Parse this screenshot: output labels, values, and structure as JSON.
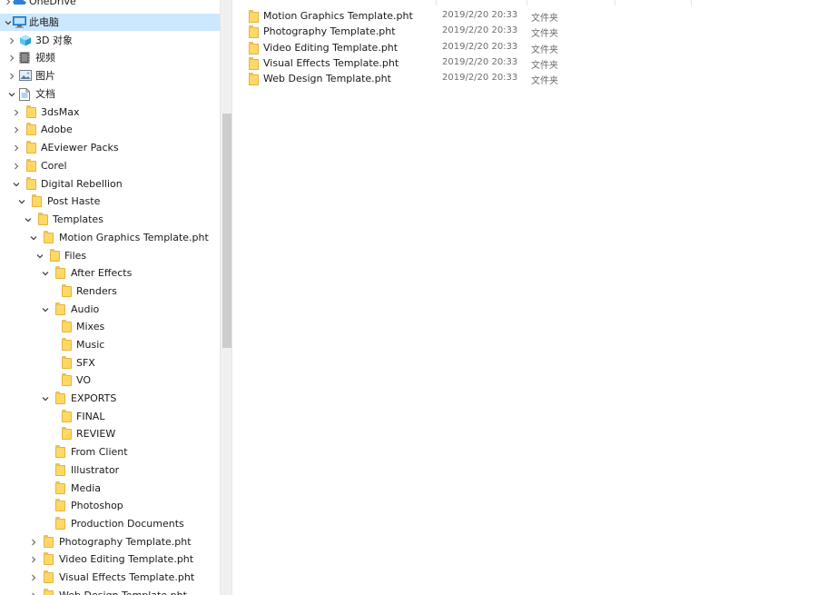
{
  "nav_tree": [
    {
      "label": "OneDrive",
      "icon": "cloud-icon",
      "chevron": "right"
    },
    {
      "label": "此电脑",
      "icon": "computer-icon",
      "chevron": "down",
      "selected": true
    },
    {
      "label": "3D 对象",
      "icon": "cube-3d-icon",
      "chevron": "right"
    },
    {
      "label": "视频",
      "icon": "video-icon",
      "chevron": "right"
    },
    {
      "label": "图片",
      "icon": "pictures-icon",
      "chevron": "right"
    },
    {
      "label": "文档",
      "icon": "documents-icon",
      "chevron": "down"
    },
    {
      "label": "3dsMax",
      "icon": "folder-icon",
      "chevron": "right"
    },
    {
      "label": "Adobe",
      "icon": "folder-icon",
      "chevron": "right"
    },
    {
      "label": "AEviewer Packs",
      "icon": "folder-icon",
      "chevron": "right"
    },
    {
      "label": "Corel",
      "icon": "folder-icon",
      "chevron": "right"
    },
    {
      "label": "Digital Rebellion",
      "icon": "folder-icon",
      "chevron": "down"
    },
    {
      "label": "Post Haste",
      "icon": "folder-icon",
      "chevron": "down"
    },
    {
      "label": "Templates",
      "icon": "folder-icon",
      "chevron": "down"
    },
    {
      "label": "Motion Graphics Template.pht",
      "icon": "folder-icon",
      "chevron": "down"
    },
    {
      "label": "Files",
      "icon": "folder-icon",
      "chevron": "down"
    },
    {
      "label": "After Effects",
      "icon": "folder-icon",
      "chevron": "down"
    },
    {
      "label": "Renders",
      "icon": "folder-icon",
      "chevron": "none"
    },
    {
      "label": "Audio",
      "icon": "folder-icon",
      "chevron": "down"
    },
    {
      "label": "Mixes",
      "icon": "folder-icon",
      "chevron": "none"
    },
    {
      "label": "Music",
      "icon": "folder-icon",
      "chevron": "none"
    },
    {
      "label": "SFX",
      "icon": "folder-icon",
      "chevron": "none"
    },
    {
      "label": "VO",
      "icon": "folder-icon",
      "chevron": "none"
    },
    {
      "label": "EXPORTS",
      "icon": "folder-icon",
      "chevron": "down"
    },
    {
      "label": "FINAL",
      "icon": "folder-icon",
      "chevron": "none"
    },
    {
      "label": "REVIEW",
      "icon": "folder-icon",
      "chevron": "none"
    },
    {
      "label": "From Client",
      "icon": "folder-icon",
      "chevron": "none"
    },
    {
      "label": "Illustrator",
      "icon": "folder-icon",
      "chevron": "none"
    },
    {
      "label": "Media",
      "icon": "folder-icon",
      "chevron": "none"
    },
    {
      "label": "Photoshop",
      "icon": "folder-icon",
      "chevron": "none"
    },
    {
      "label": "Production Documents",
      "icon": "folder-icon",
      "chevron": "none"
    },
    {
      "label": "Photography Template.pht",
      "icon": "folder-icon",
      "chevron": "right"
    },
    {
      "label": "Video Editing Template.pht",
      "icon": "folder-icon",
      "chevron": "right"
    },
    {
      "label": "Visual Effects Template.pht",
      "icon": "folder-icon",
      "chevron": "right"
    },
    {
      "label": "Web Design Template.pht",
      "icon": "folder-icon",
      "chevron": "right"
    }
  ],
  "files": [
    {
      "name": "Motion Graphics Template.pht",
      "date": "2019/2/20 20:33",
      "type": "文件夹"
    },
    {
      "name": "Photography Template.pht",
      "date": "2019/2/20 20:33",
      "type": "文件夹"
    },
    {
      "name": "Video Editing Template.pht",
      "date": "2019/2/20 20:33",
      "type": "文件夹"
    },
    {
      "name": "Visual Effects Template.pht",
      "date": "2019/2/20 20:33",
      "type": "文件夹"
    },
    {
      "name": "Web Design Template.pht",
      "date": "2019/2/20 20:33",
      "type": "文件夹"
    }
  ],
  "colors": {
    "selection": "#cce8ff",
    "folder": "#ffd866",
    "secondary_text": "#6d6d6d"
  }
}
